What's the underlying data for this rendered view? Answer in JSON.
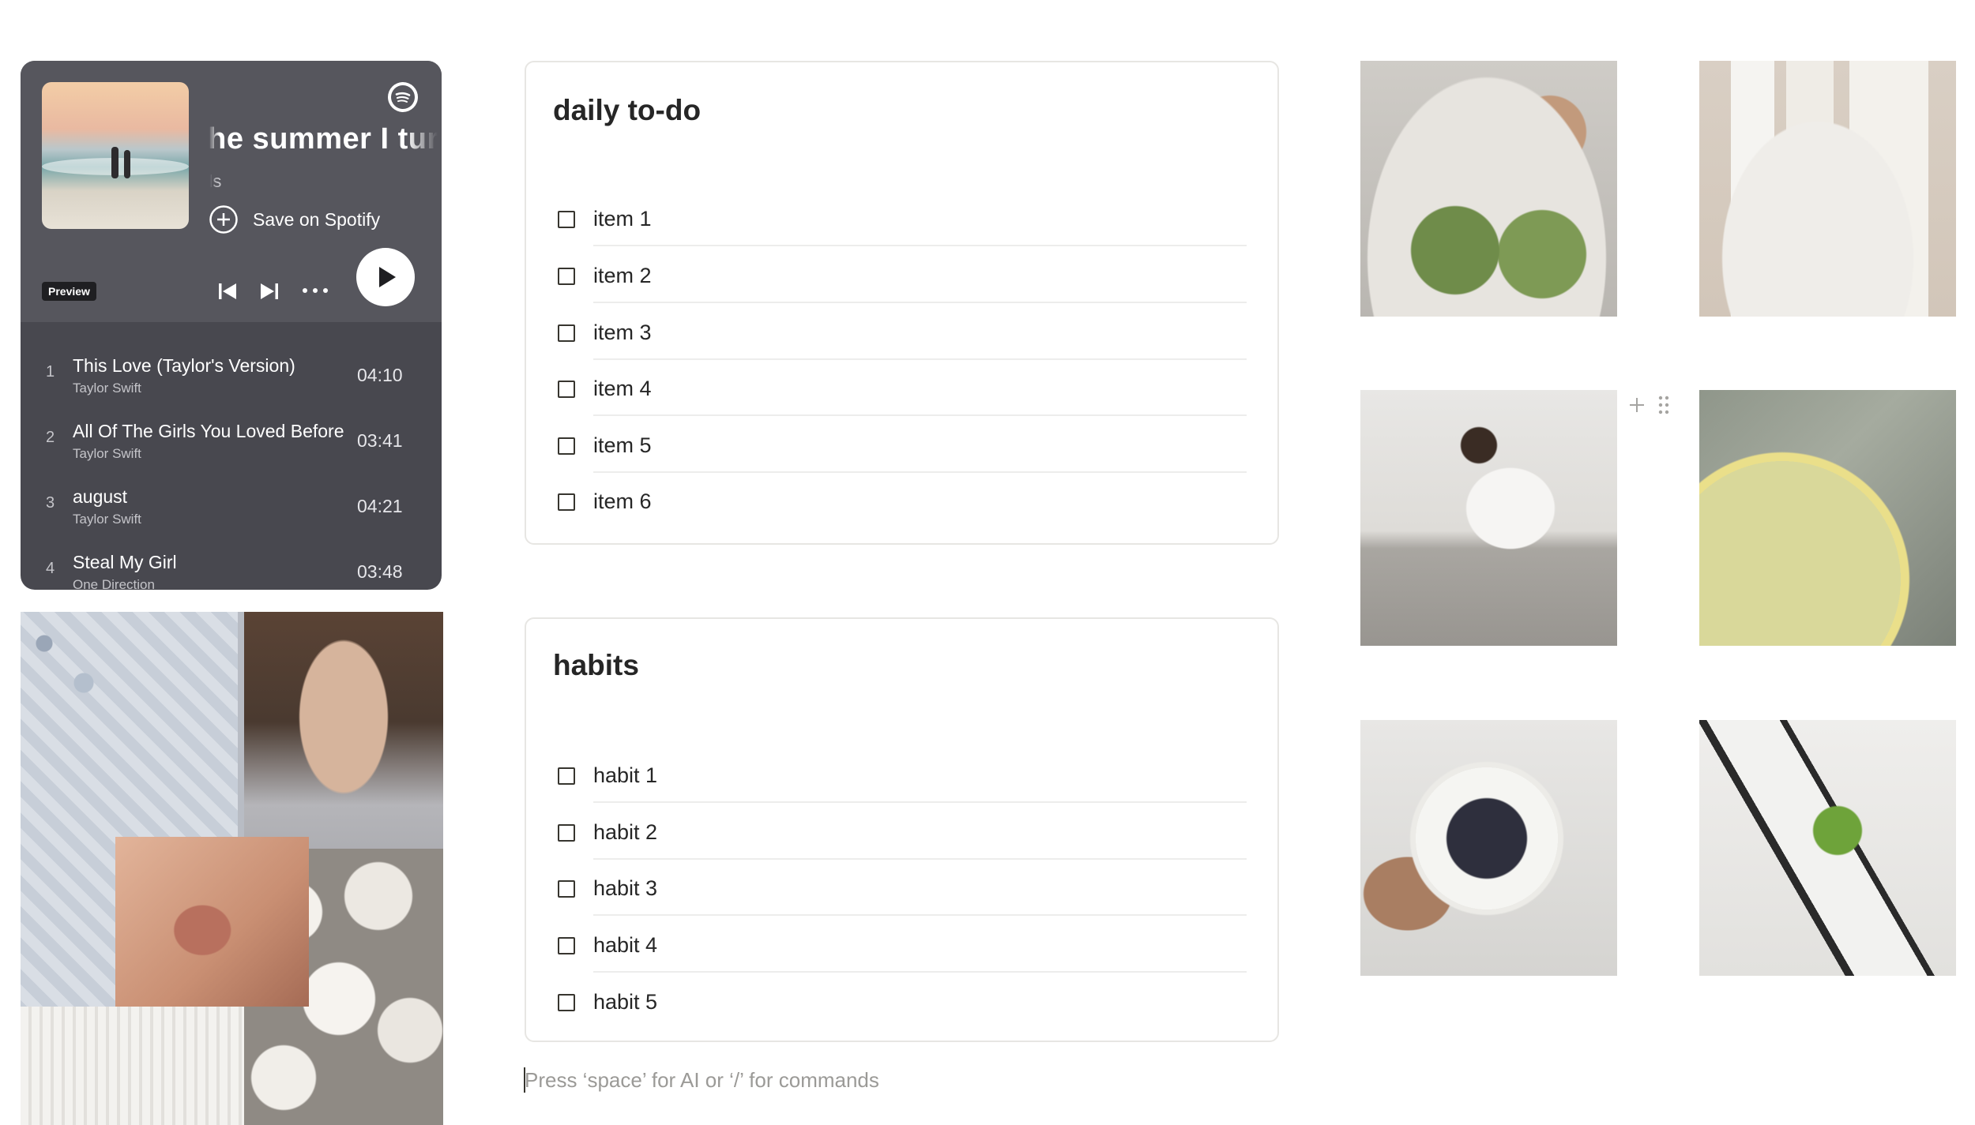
{
  "spotify": {
    "title": "the summer I turned pretty",
    "artist_fragment": "nels",
    "save_label": "Save on Spotify",
    "preview_badge": "Preview",
    "icons": [
      "spotify-logo-icon",
      "add-circle-icon",
      "skip-previous-icon",
      "skip-next-icon",
      "more-icon",
      "play-icon"
    ],
    "tracks": [
      {
        "num": "1",
        "name": "This Love (Taylor's Version)",
        "artist": "Taylor Swift",
        "duration": "04:10"
      },
      {
        "num": "2",
        "name": "All Of The Girls You Loved Before",
        "artist": "Taylor Swift",
        "duration": "03:41"
      },
      {
        "num": "3",
        "name": "august",
        "artist": "Taylor Swift",
        "duration": "04:21"
      },
      {
        "num": "4",
        "name": "Steal My Girl",
        "artist": "One Direction",
        "duration": "03:48"
      }
    ],
    "colors": {
      "panel": "#48484f",
      "header": "#56565d"
    }
  },
  "todo": {
    "title": "daily to-do",
    "items": [
      {
        "label": "item 1",
        "checked": false
      },
      {
        "label": "item 2",
        "checked": false
      },
      {
        "label": "item 3",
        "checked": false
      },
      {
        "label": "item 4",
        "checked": false
      },
      {
        "label": "item 5",
        "checked": false
      },
      {
        "label": "item 6",
        "checked": false
      }
    ]
  },
  "habits": {
    "title": "habits",
    "items": [
      {
        "label": "habit 1",
        "checked": false
      },
      {
        "label": "habit 2",
        "checked": false
      },
      {
        "label": "habit 3",
        "checked": false
      },
      {
        "label": "habit 4",
        "checked": false
      },
      {
        "label": "habit 5",
        "checked": false
      }
    ]
  },
  "editor": {
    "placeholder": "Press ‘space’ for AI or ‘/’ for commands"
  }
}
